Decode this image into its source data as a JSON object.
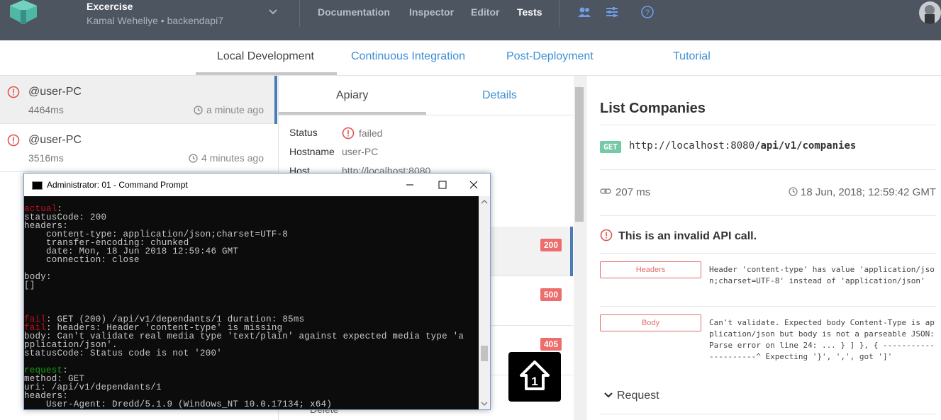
{
  "topbar": {
    "project_title": "Excercise",
    "project_subtitle": "Kamal Weheliye • backendapi7",
    "nav": [
      "Documentation",
      "Inspector",
      "Editor",
      "Tests"
    ],
    "active_nav": "Tests"
  },
  "tabs": [
    "Local Development",
    "Continuous Integration",
    "Post-Deployment",
    "Tutorial"
  ],
  "runs": [
    {
      "name": "@user-PC",
      "duration": "4464ms",
      "ago": "a minute ago"
    },
    {
      "name": "@user-PC",
      "duration": "3516ms",
      "ago": "4 minutes ago"
    }
  ],
  "middle": {
    "tabs": [
      "Apiary",
      "Details"
    ],
    "status_label": "Status",
    "status_value": "failed",
    "hostname_label": "Hostname",
    "hostname_value": "user-PC",
    "host_label": "Host",
    "host_value": "http://localhost:8080",
    "codes": [
      "200",
      "500",
      "405"
    ],
    "delete_label": "Delete"
  },
  "right": {
    "title": "List Companies",
    "method": "GET",
    "url_base": "http://localhost:8080",
    "url_path": "/api/v1/companies",
    "duration": "207 ms",
    "timestamp": "18 Jun, 2018; 12:59:42 GMT",
    "invalid_text": "This is an invalid API call.",
    "errors": [
      {
        "label": "Headers",
        "message": "Header 'content-type' has value 'application/json;charset=UTF-8' instead of 'application/json'"
      },
      {
        "label": "Body",
        "message": "Can't validate. Expected body Content-Type is application/json but body is not a parseable JSON: Parse error on line 24: ... } ] }, { ---------------------^ Expecting '}', ',', got ']'"
      }
    ],
    "request_label": "Request"
  },
  "cmd": {
    "title": "Administrator: 01 - Command Prompt",
    "lines": [
      {
        "tag": "actual",
        "tag_color": "red",
        "text": ":"
      },
      {
        "text": "statusCode: 200"
      },
      {
        "text": "headers:"
      },
      {
        "text": "    content-type: application/json;charset=UTF-8"
      },
      {
        "text": "    transfer-encoding: chunked"
      },
      {
        "text": "    date: Mon, 18 Jun 2018 12:59:46 GMT"
      },
      {
        "text": "    connection: close"
      },
      {
        "text": ""
      },
      {
        "text": "body:"
      },
      {
        "text": "[]"
      },
      {
        "text": ""
      },
      {
        "text": ""
      },
      {
        "text": ""
      },
      {
        "tag": "fail",
        "tag_color": "red",
        "text": ": GET (200) /api/v1/dependants/1 duration: 85ms"
      },
      {
        "tag": "fail",
        "tag_color": "red",
        "text": ": headers: Header 'content-type' is missing"
      },
      {
        "text": "body: Can't validate real media type 'text/plain' against expected media type 'a"
      },
      {
        "text": "pplication/json'."
      },
      {
        "text": "statusCode: Status code is not '200'"
      },
      {
        "text": ""
      },
      {
        "tag": "request",
        "tag_color": "green",
        "text": ":"
      },
      {
        "text": "method: GET"
      },
      {
        "text": "uri: /api/v1/dependants/1"
      },
      {
        "text": "headers:"
      },
      {
        "text": "    User-Agent: Dredd/5.1.9 (Windows_NT 10.0.17134; x64)"
      }
    ]
  },
  "colors": {
    "topbar": "#4d5561",
    "accent_blue": "#3d8fd4",
    "error_red": "#ec6d6b",
    "get_green": "#75c9a6"
  }
}
